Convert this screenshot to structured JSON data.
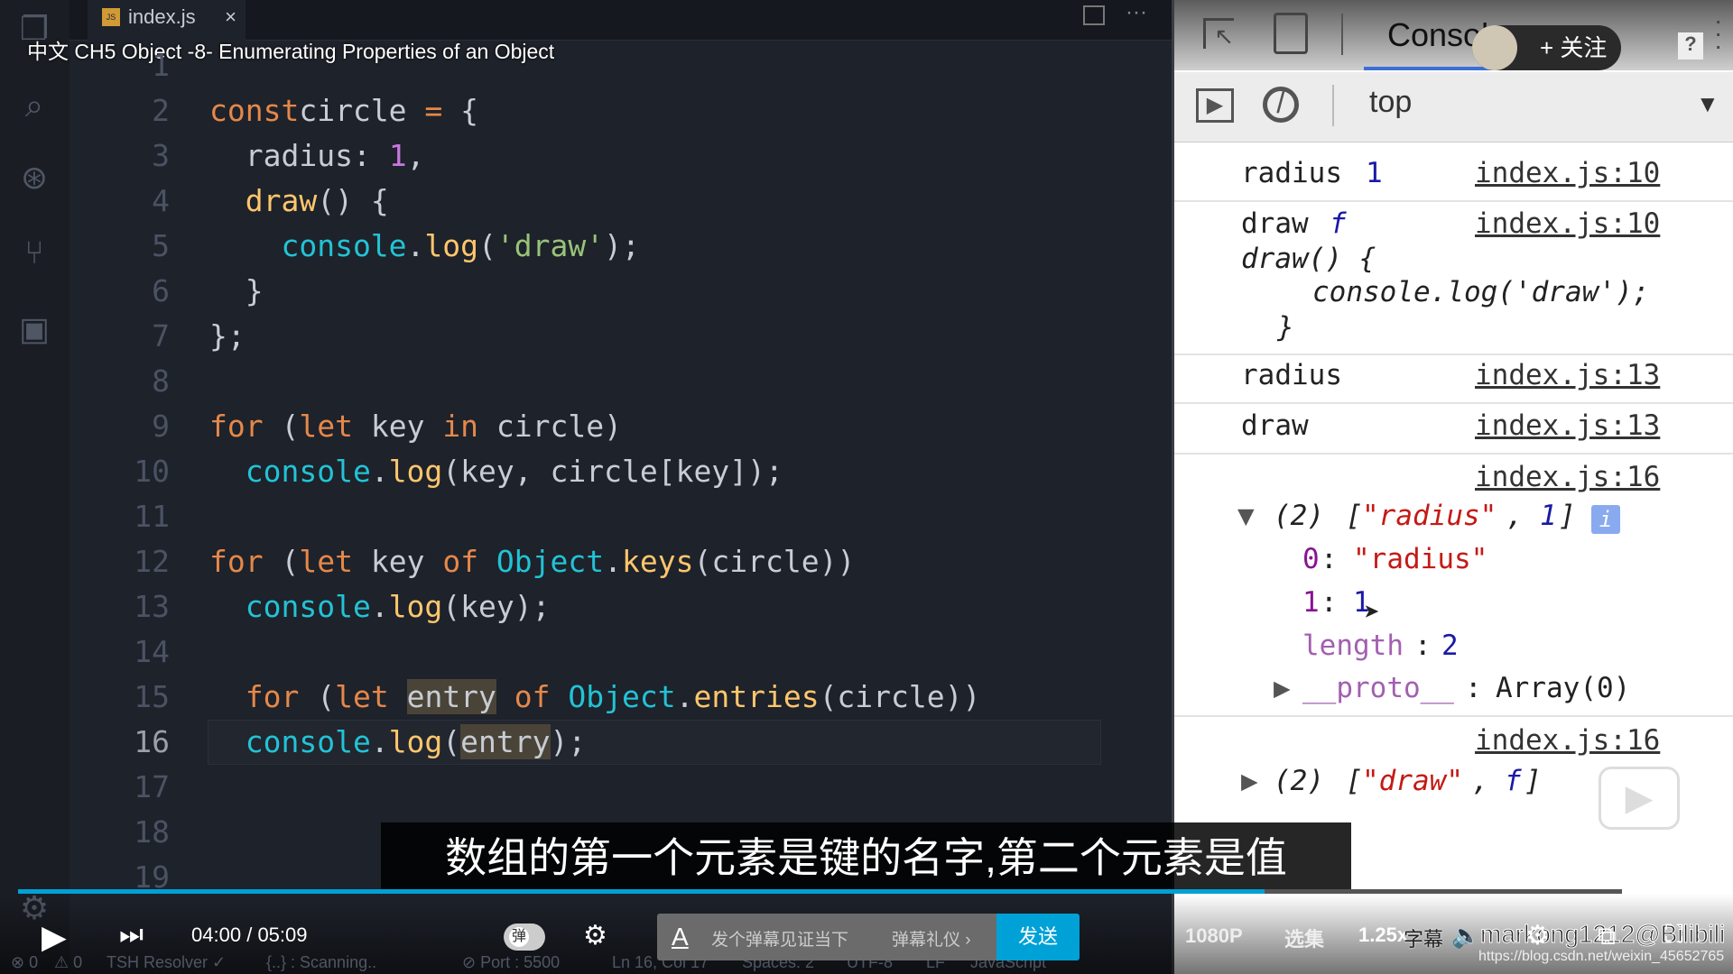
{
  "editor": {
    "tab": {
      "filename": "index.js",
      "icon": "js-file-icon",
      "close": "×"
    },
    "video_title": "中文 CH5 Object -8- Enumerating Properties of an Object",
    "line_numbers": [
      "1",
      "2",
      "3",
      "4",
      "5",
      "6",
      "7",
      "8",
      "9",
      "10",
      "11",
      "12",
      "13",
      "14",
      "15",
      "16",
      "17",
      "18",
      "19"
    ]
  },
  "devtools": {
    "tab": "Console",
    "context": "top",
    "follow_label": "+ 关注",
    "help": "?",
    "logs": {
      "r1_key": "radius",
      "r1_val": "1",
      "r1_link": "index.js:10",
      "r2_key": "draw",
      "r2_f": "f",
      "r2_link": "index.js:10",
      "r2_l1": "draw() {",
      "r2_l2": "console.log('draw');",
      "r2_l3": "}",
      "r3": "radius",
      "r3_link": "index.js:13",
      "r4": "draw",
      "r4_link": "index.js:13",
      "r5_link": "index.js:16",
      "r5_count": "(2)",
      "r5_open": "[",
      "r5_str": "\"radius\"",
      "r5_comma": ",",
      "r5_num": "1",
      "r5_close": "]",
      "r5_info": "i",
      "r5_i0k": "0",
      "r5_i0v": "\"radius\"",
      "r5_i1k": "1",
      "r5_i1v": "1",
      "r5_lenk": "length",
      "r5_lenv": "2",
      "r5_proto": "__proto__",
      "r5_protov": "Array(0)",
      "r6_link": "index.js:16",
      "r6_count": "(2)",
      "r6_str": "\"draw\"",
      "r6_f": "f"
    }
  },
  "subtitle": "数组的第一个元素是键的名字,第二个元素是值",
  "player": {
    "current_time": "04:00",
    "separator": "/",
    "duration": "05:09",
    "progress": 0.777,
    "danmu_toggle": "弹",
    "danmu_placeholder": "发个弹幕见证当下",
    "danmu_etiquette": "弹幕礼仪 ›",
    "send": "发送",
    "quality": "1080P",
    "episodes": "选集",
    "speed": "1.25x",
    "subtitle_btn": "字幕",
    "watermark": "markong1212@Bilibili",
    "url_watermark": "https://blog.csdn.net/weixin_45652765",
    "accent": "#00a1d6"
  },
  "statusbar": {
    "errors": "⊗ 0",
    "warnings": "⚠ 0",
    "resolver": "TSH Resolver ✓",
    "scanning": "{..} : Scanning..",
    "port": "⊘ Port : 5500",
    "position": "Ln 16, Col 17",
    "spaces": "Spaces: 2",
    "encoding": "UTF-8",
    "eol": "LF",
    "language": "JavaScript"
  }
}
